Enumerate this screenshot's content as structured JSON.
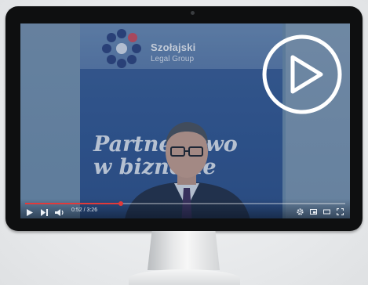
{
  "video": {
    "logo_line1": "Szołajski",
    "logo_line2": "Legal Group",
    "tagline_line1": "Partnerstwo",
    "tagline_line2": "w biznesie",
    "time_display": "0:52 / 3:26",
    "progress_fraction": 0.3,
    "accent_color": "#e23a3a"
  },
  "icons": {
    "play_overlay": "play-circle-icon",
    "play": "play-icon",
    "next": "next-icon",
    "volume": "volume-icon",
    "settings": "gear-icon",
    "miniplayer": "miniplayer-icon",
    "theater": "theater-icon",
    "fullscreen": "fullscreen-icon"
  }
}
